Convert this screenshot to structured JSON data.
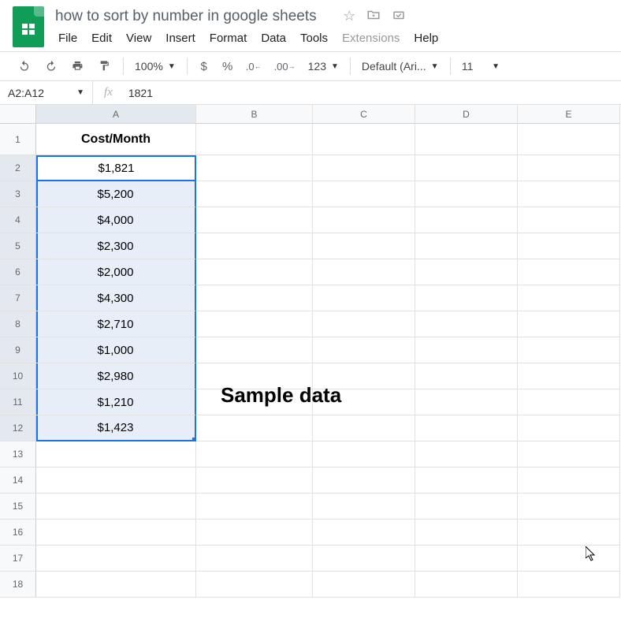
{
  "app_icon": "sheets",
  "doc_title": "how to sort by number in google sheets",
  "title_icons": [
    "star-icon",
    "folder-icon",
    "cloud-status-icon"
  ],
  "menubar": [
    "File",
    "Edit",
    "View",
    "Insert",
    "Format",
    "Data",
    "Tools",
    "Extensions",
    "Help"
  ],
  "toolbar": {
    "zoom": "100%",
    "currency": "$",
    "percent": "%",
    "dec_down": ".0",
    "dec_up": ".00",
    "more_formats": "123",
    "font": "Default (Ari...",
    "font_size": "11"
  },
  "name_box": "A2:A12",
  "formula_value": "1821",
  "columns": [
    "A",
    "B",
    "C",
    "D",
    "E"
  ],
  "rows": [
    1,
    2,
    3,
    4,
    5,
    6,
    7,
    8,
    9,
    10,
    11,
    12,
    13,
    14,
    15,
    16,
    17,
    18
  ],
  "cells": {
    "A1": "Cost/Month",
    "A2": "$1,821",
    "A3": "$5,200",
    "A4": "$4,000",
    "A5": "$2,300",
    "A6": "$2,000",
    "A7": "$4,300",
    "A8": "$2,710",
    "A9": "$1,000",
    "A10": "$2,980",
    "A11": "$1,210",
    "A12": "$1,423"
  },
  "overlay_text": "Sample data",
  "active_cell": "A2",
  "selection": "A2:A12"
}
